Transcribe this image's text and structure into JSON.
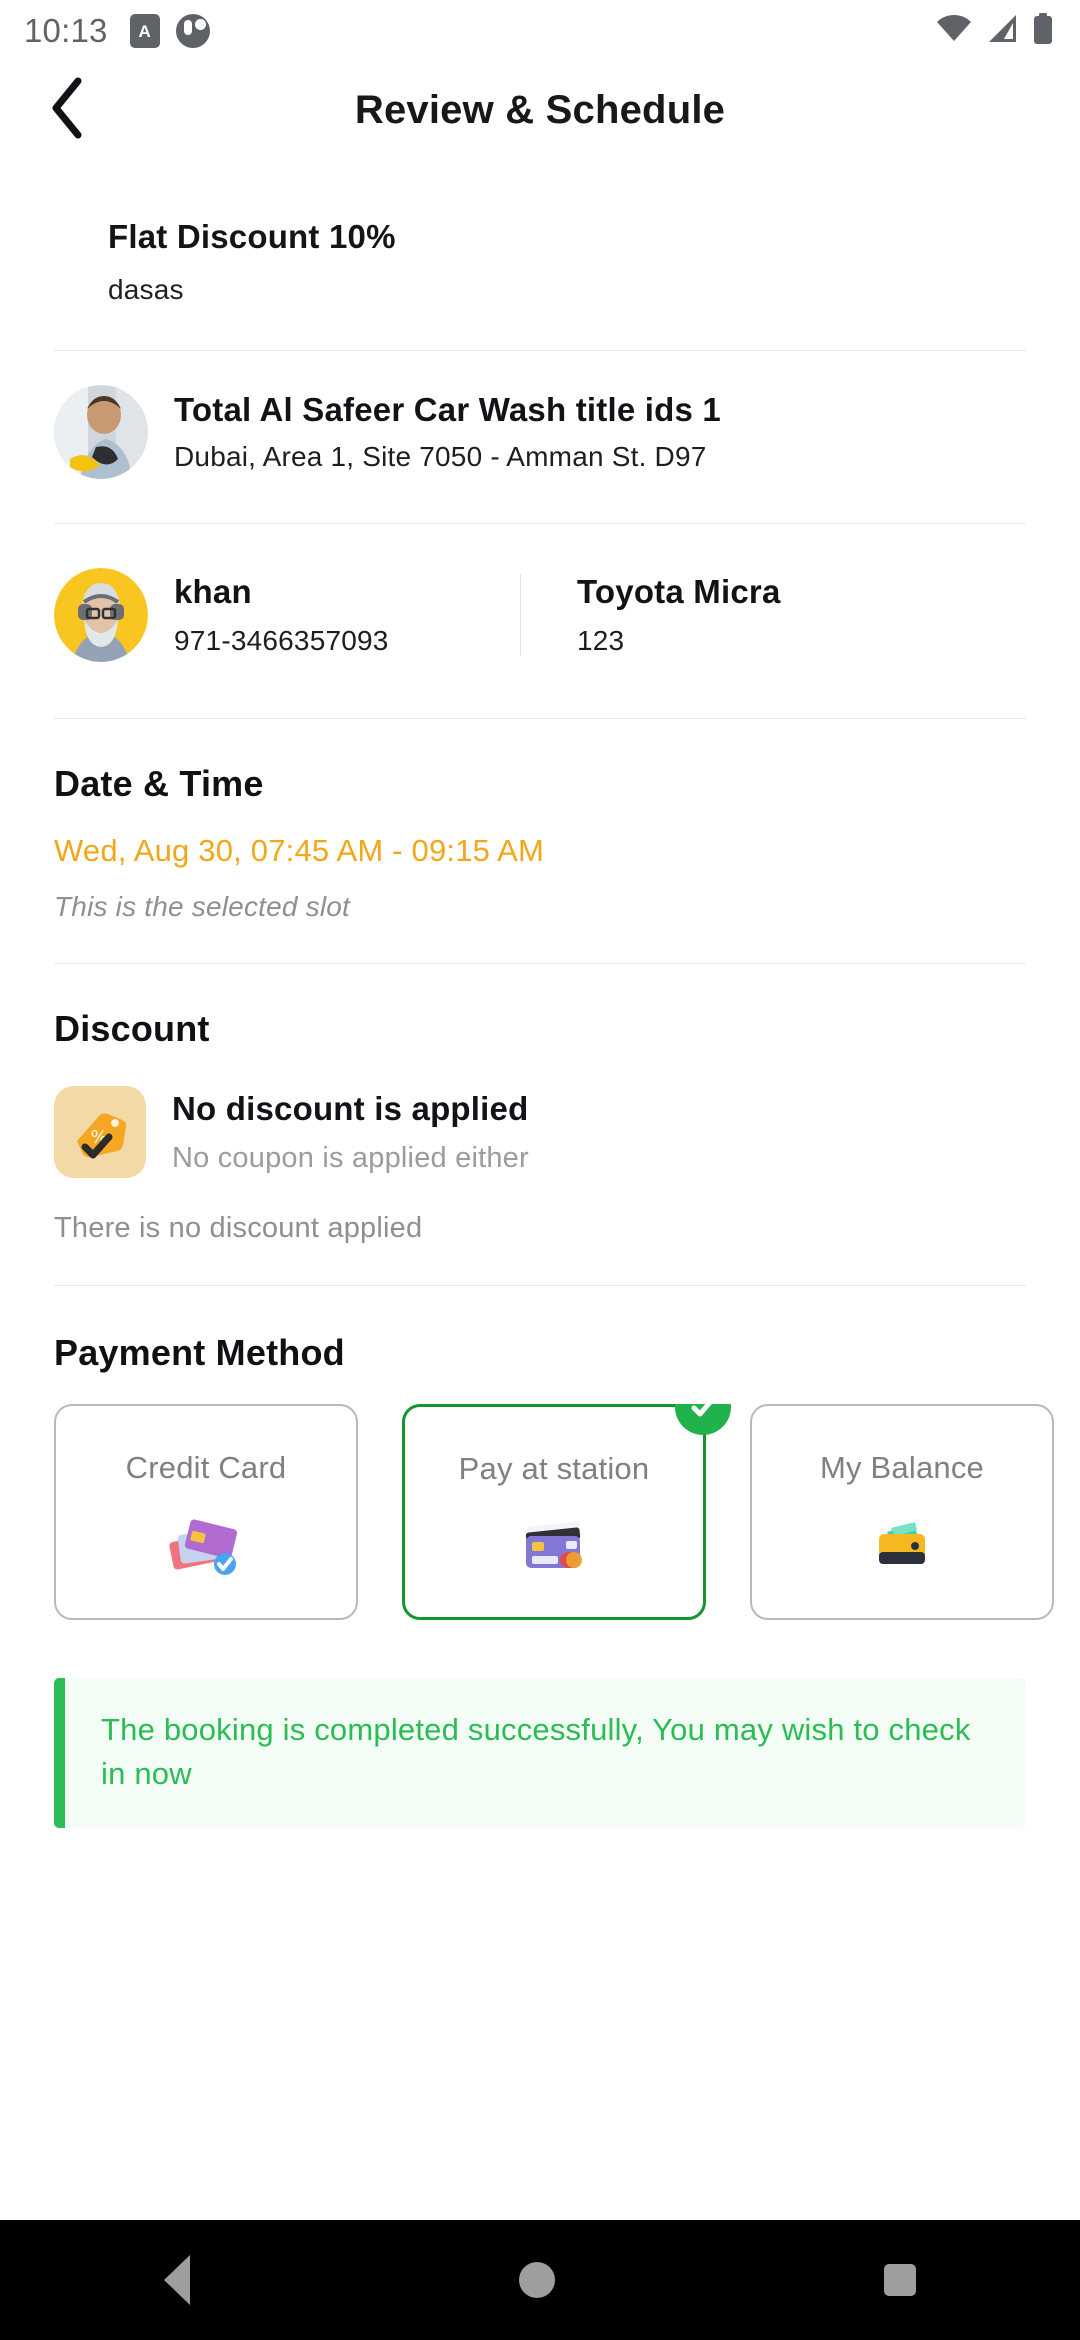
{
  "statusbar": {
    "time": "10:13",
    "badge_letter": "A",
    "icons": [
      "app-badge-icon",
      "clock-icon",
      "wifi-icon",
      "cellular-signal-icon",
      "battery-icon"
    ]
  },
  "header": {
    "title": "Review & Schedule",
    "back_icon": "chevron-left-icon"
  },
  "offer": {
    "title": "Flat Discount 10%",
    "subtitle": "dasas"
  },
  "service": {
    "name": "Total Al Safeer Car Wash  title ids 1",
    "address": "Dubai, Area 1, Site 7050 - Amman St. D97",
    "avatar": "car-wash-worker-photo"
  },
  "customer": {
    "name": "khan",
    "phone": "971-3466357093",
    "avatar": "customer-photo"
  },
  "vehicle": {
    "model": "Toyota Micra",
    "plate": "123"
  },
  "datetime_section": {
    "heading": "Date & Time",
    "value": "Wed, Aug 30, 07:45 AM - 09:15 AM",
    "note": "This is the selected slot",
    "accent_color": "#f2a71b"
  },
  "discount_section": {
    "heading": "Discount",
    "title": "No discount is applied",
    "subtitle": "No coupon is applied either",
    "footnote": "There is no discount applied",
    "icon": "discount-tag-icon"
  },
  "payment_section": {
    "heading": "Payment Method",
    "selected_index": 1,
    "methods": [
      {
        "label": "Credit Card",
        "icon": "credit-cards-icon",
        "selected": false
      },
      {
        "label": "Pay at station",
        "icon": "card-terminal-icon",
        "selected": true
      },
      {
        "label": "My Balance",
        "icon": "wallet-icon",
        "selected": false
      }
    ],
    "selected_color": "#13952f"
  },
  "banner": {
    "message": "The booking is completed successfully, You may wish to check in now",
    "color": "#2bbd54",
    "background": "#f4fcf6"
  },
  "navbar": {
    "back": "nav-back-icon",
    "home": "nav-home-icon",
    "recents": "nav-recents-icon"
  }
}
